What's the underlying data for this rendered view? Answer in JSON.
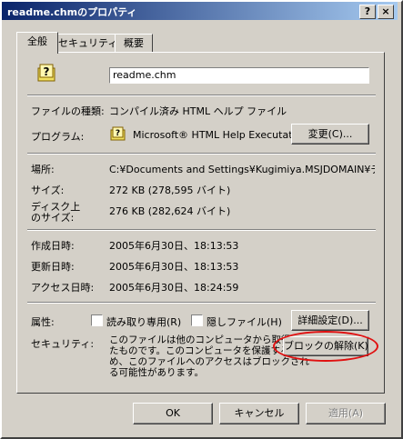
{
  "window": {
    "title": "readme.chmのプロパティ",
    "help_btn": "?",
    "close_btn": "×"
  },
  "tabs": [
    {
      "label": "全般"
    },
    {
      "label": "セキュリティ"
    },
    {
      "label": "概要"
    }
  ],
  "general": {
    "filename": "readme.chm",
    "file_type_label": "ファイルの種類:",
    "file_type_value": "コンパイル済み HTML ヘルプ ファイル",
    "program_label": "プログラム:",
    "program_value": "Microsoft® HTML Help Executat",
    "change_button": "変更(C)...",
    "location_label": "場所:",
    "location_value": "C:¥Documents and Settings¥Kugimiya.MSJDOMAIN¥デス",
    "size_label": "サイズ:",
    "size_value": "272 KB (278,595 バイト)",
    "disk_size_label_1": "ディスク上",
    "disk_size_label_2": "のサイズ:",
    "disk_size_value": "276 KB (282,624 バイト)",
    "created_label": "作成日時:",
    "created_value": "2005年6月30日、18:13:53",
    "modified_label": "更新日時:",
    "modified_value": "2005年6月30日、18:13:53",
    "accessed_label": "アクセス日時:",
    "accessed_value": "2005年6月30日、18:24:59",
    "attributes_label": "属性:",
    "readonly_label": "読み取り専用(R)",
    "hidden_label": "隠しファイル(H)",
    "advanced_button": "詳細設定(D)...",
    "security_label": "セキュリティ:",
    "security_text_1": "このファイルは他のコンピュータから取得",
    "security_text_2": "たものです。このコンピュータを保護するた",
    "security_text_3": "め、このファイルへのアクセスはブロックされ",
    "security_text_4": "る可能性があります。",
    "unblock_button": "ブロックの解除(K)"
  },
  "footer": {
    "ok": "OK",
    "cancel": "キャンセル",
    "apply": "適用(A)"
  },
  "colors": {
    "titlebar_start": "#0a246a",
    "titlebar_end": "#a6caf0",
    "highlight_circle": "#e01010"
  }
}
